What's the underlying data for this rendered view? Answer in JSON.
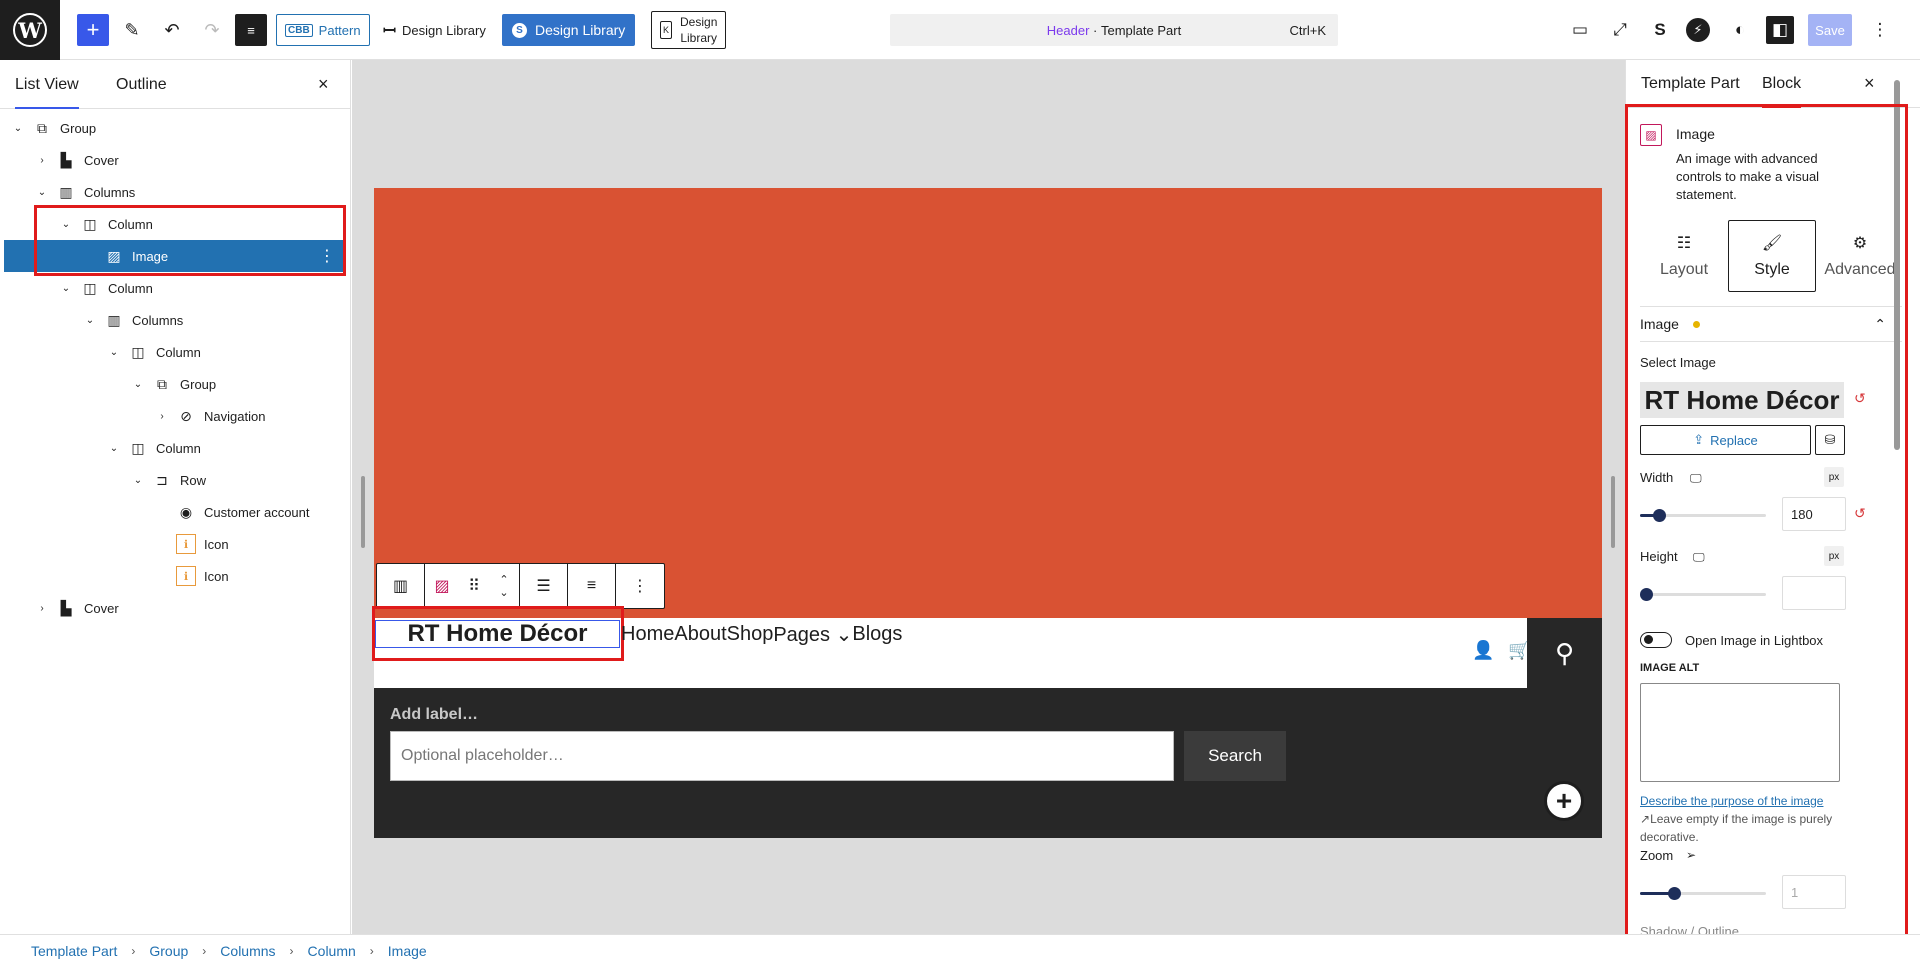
{
  "topbar": {
    "logo": "W",
    "add": "+",
    "pattern_badge": "CBB",
    "pattern_label": "Pattern",
    "design_library_1": "Design Library",
    "design_library_2": "Design Library",
    "design_library_2_badge": "S",
    "design_library_3_l1": "Design",
    "design_library_3_l2": "Library",
    "design_library_3_badge": "K",
    "command_template": "Header",
    "command_sep": " · ",
    "command_type": "Template Part",
    "command_shortcut": "Ctrl+K",
    "save": "Save",
    "spectra_badge": "S",
    "bolt_badge": "⚡"
  },
  "list_view": {
    "tab_list": "List View",
    "tab_outline": "Outline",
    "close": "×",
    "items": [
      {
        "label": "Group",
        "icon": "group-icon",
        "chevron": "⌄"
      },
      {
        "label": "Cover",
        "icon": "cover-icon",
        "chevron": "›"
      },
      {
        "label": "Columns",
        "icon": "columns-icon",
        "chevron": "⌄"
      },
      {
        "label": "Column",
        "icon": "column-icon",
        "chevron": "⌄"
      },
      {
        "label": "Image",
        "icon": "image-icon",
        "chevron": "",
        "more": "⋮"
      },
      {
        "label": "Column",
        "icon": "column-icon",
        "chevron": "⌄"
      },
      {
        "label": "Columns",
        "icon": "columns-icon",
        "chevron": "⌄"
      },
      {
        "label": "Column",
        "icon": "column-icon",
        "chevron": "⌄"
      },
      {
        "label": "Group",
        "icon": "group-icon",
        "chevron": "⌄"
      },
      {
        "label": "Navigation",
        "icon": "navigation-icon",
        "chevron": "›"
      },
      {
        "label": "Column",
        "icon": "column-icon",
        "chevron": "⌄"
      },
      {
        "label": "Row",
        "icon": "row-icon",
        "chevron": "⌄"
      },
      {
        "label": "Customer account",
        "icon": "customer-account-icon",
        "chevron": ""
      },
      {
        "label": "Icon",
        "icon": "icon-block-icon",
        "chevron": ""
      },
      {
        "label": "Icon",
        "icon": "icon-block-icon",
        "chevron": ""
      },
      {
        "label": "Cover",
        "icon": "cover-icon",
        "chevron": "›"
      }
    ]
  },
  "canvas": {
    "site_title": "RT Home Décor",
    "nav": [
      "Home",
      "About",
      "Shop",
      "Pages ⌄",
      "Blogs"
    ],
    "search_label": "Add label…",
    "search_placeholder": "Optional placeholder…",
    "search_button": "Search",
    "colors": {
      "cover": "#d95233",
      "dark": "#272727"
    }
  },
  "settings": {
    "tab_template": "Template Part",
    "tab_block": "Block",
    "close": "×",
    "block_name": "Image",
    "block_desc": "An image with advanced controls to make a visual statement.",
    "tabs": [
      {
        "label": "Layout",
        "icon": "layout-icon"
      },
      {
        "label": "Style",
        "icon": "style-brush-icon"
      },
      {
        "label": "Advanced",
        "icon": "gear-icon"
      }
    ],
    "section": "Image",
    "select_image": "Select Image",
    "image_preview": "RT Home Décor",
    "replace": "Replace",
    "width_label": "Width",
    "width_value": "180",
    "width_fraction": 0.15,
    "height_label": "Height",
    "height_value": "",
    "height_fraction": 0,
    "unit": "px",
    "lightbox": "Open Image in Lightbox",
    "alt_label": "IMAGE ALT",
    "alt_link": "Describe the purpose of the image",
    "alt_help": "Leave empty if the image is purely decorative.",
    "zoom_label": "Zoom",
    "zoom_value": "1",
    "zoom_fraction": 0.27,
    "cut_row": "Shadow / Outline"
  },
  "breadcrumb": [
    "Template Part",
    "Group",
    "Columns",
    "Column",
    "Image"
  ]
}
